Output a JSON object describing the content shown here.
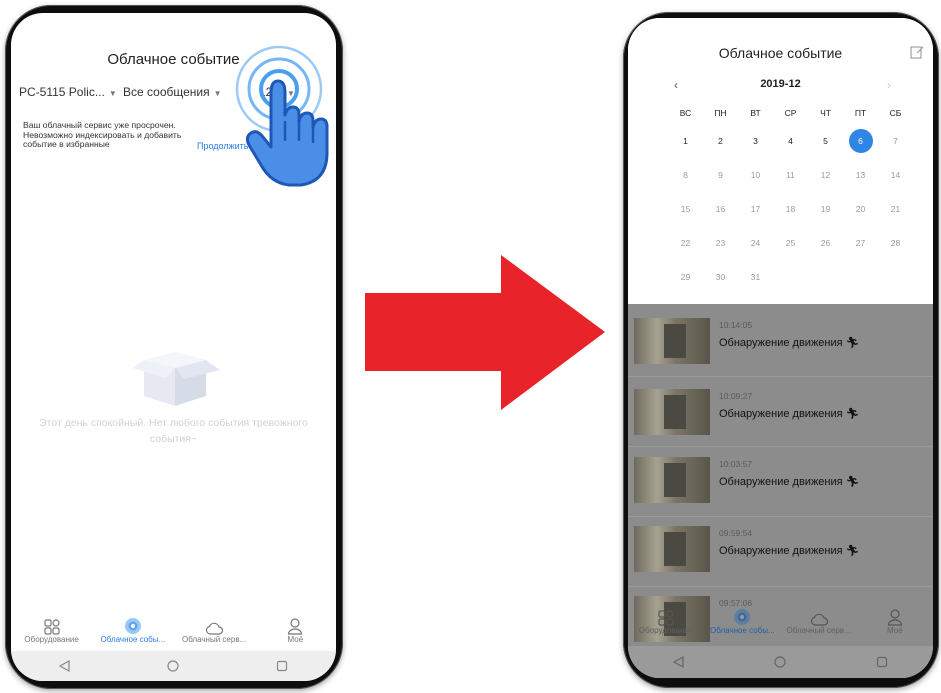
{
  "left_screen": {
    "title": "Облачное событие",
    "filters": {
      "device": "PC-5115 Polic...",
      "messages": "Все сообщения",
      "date": "12-6"
    },
    "notice": "Ваш облачный сервис уже просрочен. Невозможно индексировать и добавить событие в избранные",
    "notice_link": "Продолжить",
    "empty_message": "Этот день спокойный. Нет любого события тревожного события~"
  },
  "right_screen": {
    "title": "Облачное событие",
    "month": "2019-12",
    "weekdays": [
      "ВС",
      "ПН",
      "ВТ",
      "СР",
      "ЧТ",
      "ПТ",
      "СБ"
    ],
    "weeks": [
      [
        "1",
        "2",
        "3",
        "4",
        "5",
        "6",
        "7"
      ],
      [
        "8",
        "9",
        "10",
        "11",
        "12",
        "13",
        "14"
      ],
      [
        "15",
        "16",
        "17",
        "18",
        "19",
        "20",
        "21"
      ],
      [
        "22",
        "23",
        "24",
        "25",
        "26",
        "27",
        "28"
      ],
      [
        "29",
        "30",
        "31",
        "",
        "",
        "",
        ""
      ]
    ],
    "selected_day": "6",
    "events": [
      {
        "time": "10:14:05",
        "label": "Обнаружение движения"
      },
      {
        "time": "10:09:27",
        "label": "Обнаружение движения"
      },
      {
        "time": "10:03:57",
        "label": "Обнаружение движения"
      },
      {
        "time": "09:59:54",
        "label": "Обнаружение движения"
      },
      {
        "time": "09:57:06",
        "label": ""
      }
    ]
  },
  "tabs": [
    {
      "label": "Оборудование",
      "icon": "devices-icon"
    },
    {
      "label": "Облачное собы...",
      "icon": "cloud-event-icon"
    },
    {
      "label": "Облачный серв...",
      "icon": "cloud-icon"
    },
    {
      "label": "Моё",
      "icon": "person-icon"
    }
  ],
  "colors": {
    "accent": "#2f86e6",
    "arrow": "#e8232a",
    "dim_overlay": "#8c8c8c"
  }
}
